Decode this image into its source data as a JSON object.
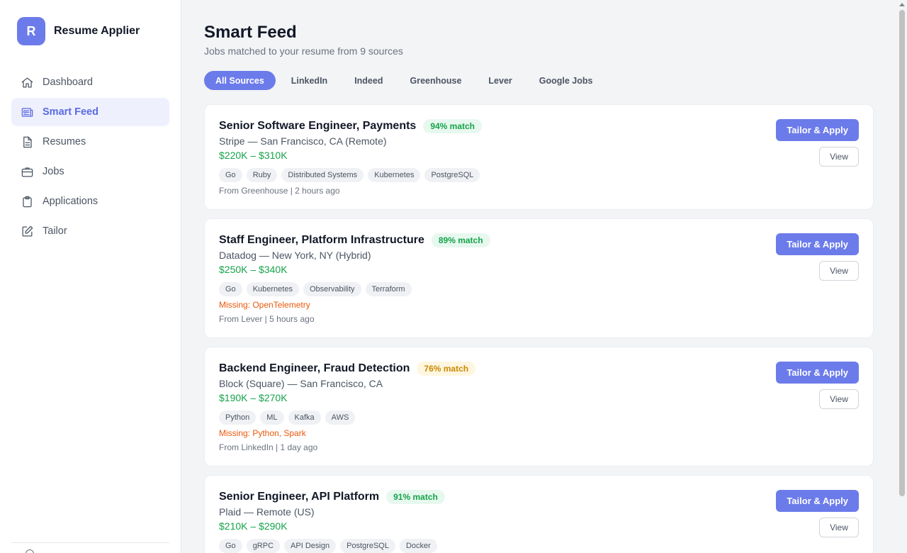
{
  "brand": {
    "logo_letter": "R",
    "name": "Resume Applier"
  },
  "sidebar": {
    "items": [
      {
        "label": "Dashboard",
        "icon": "home-icon",
        "active": false
      },
      {
        "label": "Smart Feed",
        "icon": "newspaper-icon",
        "active": true
      },
      {
        "label": "Resumes",
        "icon": "document-icon",
        "active": false
      },
      {
        "label": "Jobs",
        "icon": "briefcase-icon",
        "active": false
      },
      {
        "label": "Applications",
        "icon": "clipboard-icon",
        "active": false
      },
      {
        "label": "Tailor",
        "icon": "edit-icon",
        "active": false
      }
    ]
  },
  "page": {
    "title": "Smart Feed",
    "subtitle": "Jobs matched to your resume from 9 sources"
  },
  "tabs": [
    {
      "label": "All Sources",
      "active": true
    },
    {
      "label": "LinkedIn",
      "active": false
    },
    {
      "label": "Indeed",
      "active": false
    },
    {
      "label": "Greenhouse",
      "active": false
    },
    {
      "label": "Lever",
      "active": false
    },
    {
      "label": "Google Jobs",
      "active": false
    }
  ],
  "jobs": [
    {
      "title": "Senior Software Engineer, Payments",
      "match": "94% match",
      "match_level": "high",
      "company": "Stripe — San Francisco, CA (Remote)",
      "salary": "$220K – $310K",
      "tags": [
        "Go",
        "Ruby",
        "Distributed Systems",
        "Kubernetes",
        "PostgreSQL"
      ],
      "missing": "",
      "source": "From Greenhouse | 2 hours ago",
      "apply_label": "Tailor & Apply",
      "view_label": "View"
    },
    {
      "title": "Staff Engineer, Platform Infrastructure",
      "match": "89% match",
      "match_level": "high",
      "company": "Datadog — New York, NY (Hybrid)",
      "salary": "$250K – $340K",
      "tags": [
        "Go",
        "Kubernetes",
        "Observability",
        "Terraform"
      ],
      "missing": "Missing: OpenTelemetry",
      "source": "From Lever | 5 hours ago",
      "apply_label": "Tailor & Apply",
      "view_label": "View"
    },
    {
      "title": "Backend Engineer, Fraud Detection",
      "match": "76% match",
      "match_level": "mid",
      "company": "Block (Square) — San Francisco, CA",
      "salary": "$190K – $270K",
      "tags": [
        "Python",
        "ML",
        "Kafka",
        "AWS"
      ],
      "missing": "Missing: Python, Spark",
      "source": "From LinkedIn | 1 day ago",
      "apply_label": "Tailor & Apply",
      "view_label": "View"
    },
    {
      "title": "Senior Engineer, API Platform",
      "match": "91% match",
      "match_level": "high",
      "company": "Plaid — Remote (US)",
      "salary": "$210K – $290K",
      "tags": [
        "Go",
        "gRPC",
        "API Design",
        "PostgreSQL",
        "Docker"
      ],
      "missing": "",
      "source": "",
      "apply_label": "Tailor & Apply",
      "view_label": "View"
    }
  ],
  "colors": {
    "accent": "#6c7bea",
    "match_high": "#16a34a",
    "match_mid": "#ca8a04",
    "missing": "#ea580c"
  }
}
